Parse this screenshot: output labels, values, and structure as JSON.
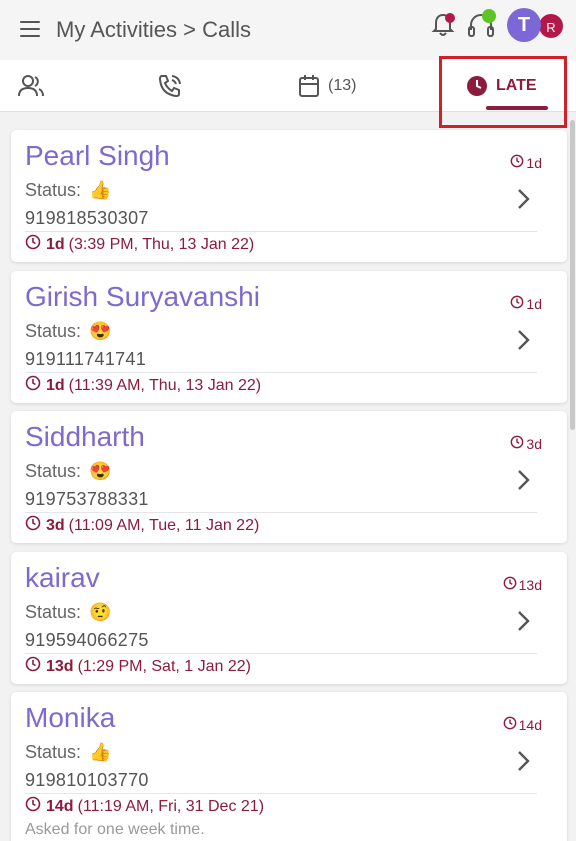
{
  "header": {
    "breadcrumb": "My Activities > Calls",
    "avatar_initial": "T",
    "avatar_secondary_initial": "R"
  },
  "tabs": [
    {
      "icon": "contacts-icon"
    },
    {
      "icon": "phone-call-icon"
    },
    {
      "icon": "calendar-icon",
      "count": "(13)"
    },
    {
      "icon": "clock-icon",
      "label": "LATE",
      "active": true
    }
  ],
  "calls": [
    {
      "name": "Pearl Singh",
      "status_label": "Status:",
      "status_emoji": "👍",
      "phone": "919818530307",
      "age_short": "1d",
      "age_bold": "1d",
      "datetime": "(3:39 PM, Thu, 13 Jan 22)"
    },
    {
      "name": "Girish Suryavanshi",
      "status_label": "Status:",
      "status_emoji": "😍",
      "phone": "919111741741",
      "age_short": "1d",
      "age_bold": "1d",
      "datetime": "(11:39 AM, Thu, 13 Jan 22)"
    },
    {
      "name": "Siddharth",
      "status_label": "Status:",
      "status_emoji": "😍",
      "phone": "919753788331",
      "age_short": "3d",
      "age_bold": "3d",
      "datetime": "(11:09 AM, Tue, 11 Jan 22)"
    },
    {
      "name": "kairav",
      "status_label": "Status:",
      "status_emoji": "🤨",
      "phone": "919594066275",
      "age_short": "13d",
      "age_bold": "13d",
      "datetime": "(1:29 PM, Sat, 1 Jan 22)"
    },
    {
      "name": "Monika",
      "status_label": "Status:",
      "status_emoji": "👍",
      "phone": "919810103770",
      "age_short": "14d",
      "age_bold": "14d",
      "datetime": "(11:19 AM, Fri, 31 Dec 21)",
      "note": "Asked for one week time."
    }
  ],
  "colors": {
    "accent": "#8c1b3c",
    "name": "#7b6bcf",
    "avatar": "#7b67d6",
    "avatar_secondary": "#b4174a",
    "highlight": "#d0202a"
  }
}
